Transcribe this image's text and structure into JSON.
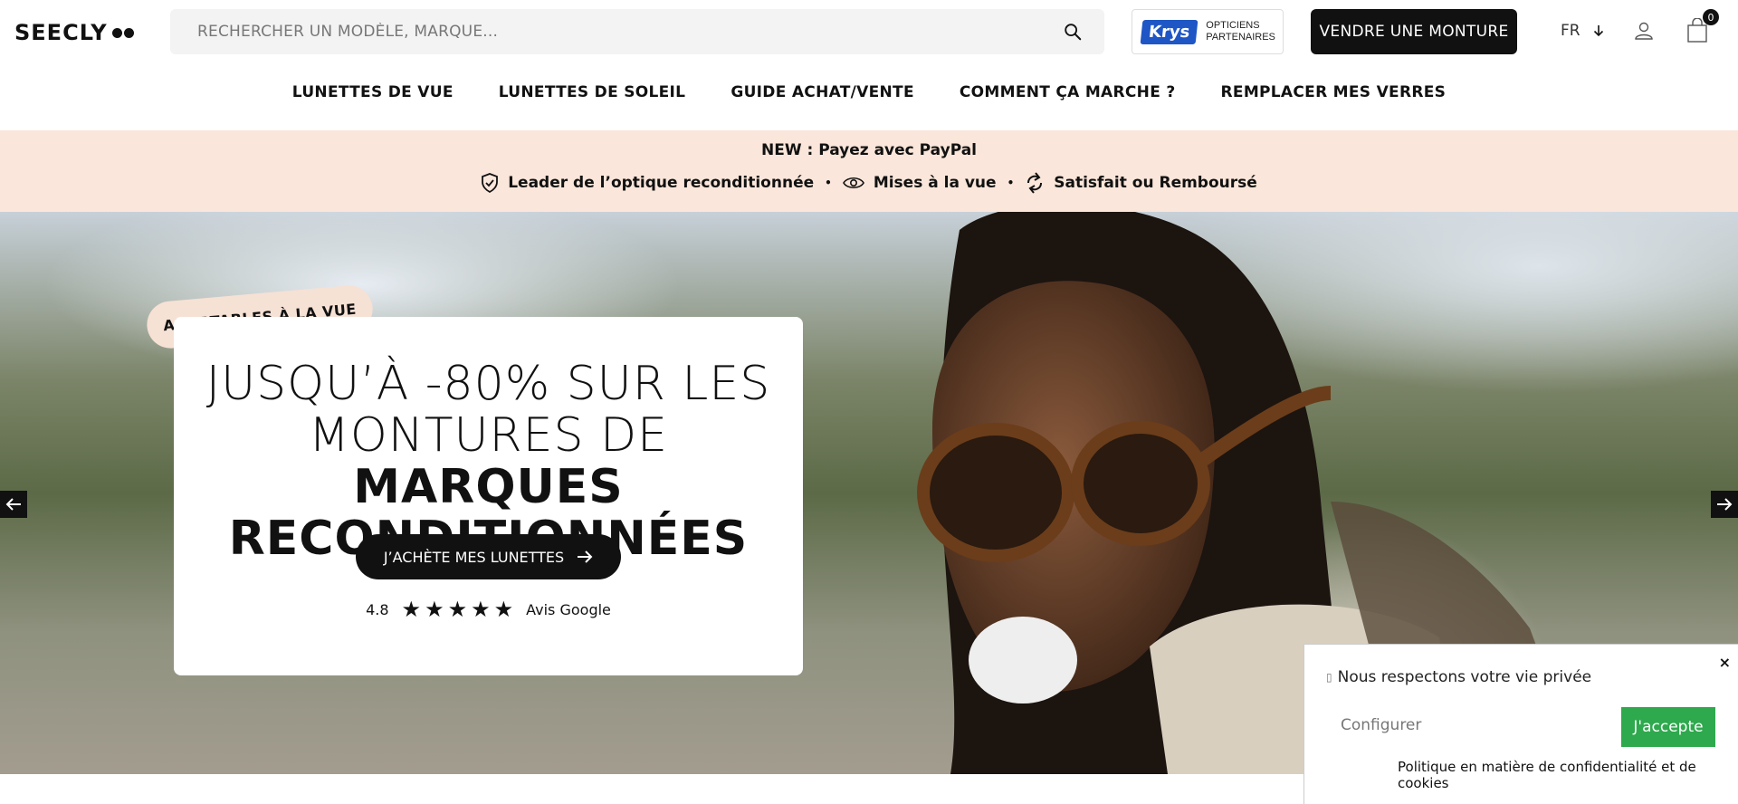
{
  "header": {
    "logo": "SEECLY",
    "search_placeholder": "RECHERCHER UN MODÈLE, MARQUE...",
    "partner_badge": "Krys",
    "partner_line1": "OPTICIENS",
    "partner_line2": "PARTENAIRES",
    "sell_button": "VENDRE UNE MONTURE",
    "language": "FR",
    "cart_count": "0"
  },
  "nav": {
    "items": [
      "LUNETTES DE VUE",
      "LUNETTES DE SOLEIL",
      "GUIDE ACHAT/VENTE",
      "COMMENT ÇA MARCHE ?",
      "REMPLACER MES VERRES"
    ]
  },
  "promo": {
    "title": "NEW : Payez avec PayPal",
    "items": [
      "Leader de l’optique reconditionnée",
      "Mises à la vue",
      "Satisfait ou Remboursé"
    ],
    "separator": "•"
  },
  "hero": {
    "sticker": "ADAPTABLES À LA VUE",
    "title_line1": "JUSQU’À -80% SUR LES",
    "title_line2_light": "MONTURES DE ",
    "title_line2_bold": "MARQUES",
    "title_line3_bold": "RECONDITIONNÉES",
    "cta": "J’ACHÈTE MES LUNETTES",
    "rating": "4.8",
    "stars": 5,
    "rating_source": "Avis Google"
  },
  "cookie": {
    "title": "Nous respectons votre vie privée",
    "configure": "Configurer",
    "accept": "J'accepte",
    "policy": "Politique en matière de confidentialité et de cookies",
    "close": "×"
  },
  "colors": {
    "promo_bg": "#fae6da",
    "accent_dark": "#111111",
    "accept_green": "#2ea94d",
    "krys_blue": "#1f56c5"
  }
}
